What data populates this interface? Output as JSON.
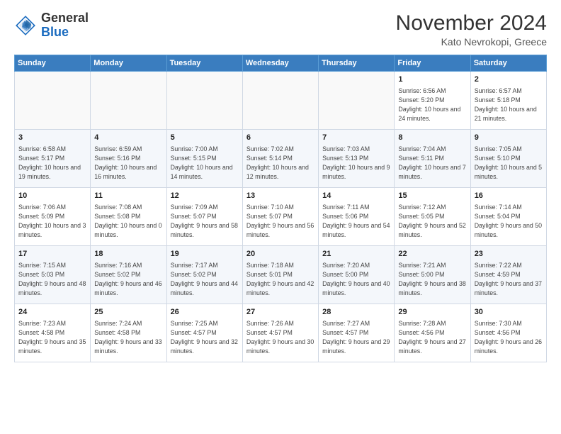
{
  "logo": {
    "line1": "General",
    "line2": "Blue"
  },
  "header": {
    "month": "November 2024",
    "location": "Kato Nevrokopi, Greece"
  },
  "days_of_week": [
    "Sunday",
    "Monday",
    "Tuesday",
    "Wednesday",
    "Thursday",
    "Friday",
    "Saturday"
  ],
  "weeks": [
    [
      {
        "day": "",
        "info": ""
      },
      {
        "day": "",
        "info": ""
      },
      {
        "day": "",
        "info": ""
      },
      {
        "day": "",
        "info": ""
      },
      {
        "day": "",
        "info": ""
      },
      {
        "day": "1",
        "info": "Sunrise: 6:56 AM\nSunset: 5:20 PM\nDaylight: 10 hours and 24 minutes."
      },
      {
        "day": "2",
        "info": "Sunrise: 6:57 AM\nSunset: 5:18 PM\nDaylight: 10 hours and 21 minutes."
      }
    ],
    [
      {
        "day": "3",
        "info": "Sunrise: 6:58 AM\nSunset: 5:17 PM\nDaylight: 10 hours and 19 minutes."
      },
      {
        "day": "4",
        "info": "Sunrise: 6:59 AM\nSunset: 5:16 PM\nDaylight: 10 hours and 16 minutes."
      },
      {
        "day": "5",
        "info": "Sunrise: 7:00 AM\nSunset: 5:15 PM\nDaylight: 10 hours and 14 minutes."
      },
      {
        "day": "6",
        "info": "Sunrise: 7:02 AM\nSunset: 5:14 PM\nDaylight: 10 hours and 12 minutes."
      },
      {
        "day": "7",
        "info": "Sunrise: 7:03 AM\nSunset: 5:13 PM\nDaylight: 10 hours and 9 minutes."
      },
      {
        "day": "8",
        "info": "Sunrise: 7:04 AM\nSunset: 5:11 PM\nDaylight: 10 hours and 7 minutes."
      },
      {
        "day": "9",
        "info": "Sunrise: 7:05 AM\nSunset: 5:10 PM\nDaylight: 10 hours and 5 minutes."
      }
    ],
    [
      {
        "day": "10",
        "info": "Sunrise: 7:06 AM\nSunset: 5:09 PM\nDaylight: 10 hours and 3 minutes."
      },
      {
        "day": "11",
        "info": "Sunrise: 7:08 AM\nSunset: 5:08 PM\nDaylight: 10 hours and 0 minutes."
      },
      {
        "day": "12",
        "info": "Sunrise: 7:09 AM\nSunset: 5:07 PM\nDaylight: 9 hours and 58 minutes."
      },
      {
        "day": "13",
        "info": "Sunrise: 7:10 AM\nSunset: 5:07 PM\nDaylight: 9 hours and 56 minutes."
      },
      {
        "day": "14",
        "info": "Sunrise: 7:11 AM\nSunset: 5:06 PM\nDaylight: 9 hours and 54 minutes."
      },
      {
        "day": "15",
        "info": "Sunrise: 7:12 AM\nSunset: 5:05 PM\nDaylight: 9 hours and 52 minutes."
      },
      {
        "day": "16",
        "info": "Sunrise: 7:14 AM\nSunset: 5:04 PM\nDaylight: 9 hours and 50 minutes."
      }
    ],
    [
      {
        "day": "17",
        "info": "Sunrise: 7:15 AM\nSunset: 5:03 PM\nDaylight: 9 hours and 48 minutes."
      },
      {
        "day": "18",
        "info": "Sunrise: 7:16 AM\nSunset: 5:02 PM\nDaylight: 9 hours and 46 minutes."
      },
      {
        "day": "19",
        "info": "Sunrise: 7:17 AM\nSunset: 5:02 PM\nDaylight: 9 hours and 44 minutes."
      },
      {
        "day": "20",
        "info": "Sunrise: 7:18 AM\nSunset: 5:01 PM\nDaylight: 9 hours and 42 minutes."
      },
      {
        "day": "21",
        "info": "Sunrise: 7:20 AM\nSunset: 5:00 PM\nDaylight: 9 hours and 40 minutes."
      },
      {
        "day": "22",
        "info": "Sunrise: 7:21 AM\nSunset: 5:00 PM\nDaylight: 9 hours and 38 minutes."
      },
      {
        "day": "23",
        "info": "Sunrise: 7:22 AM\nSunset: 4:59 PM\nDaylight: 9 hours and 37 minutes."
      }
    ],
    [
      {
        "day": "24",
        "info": "Sunrise: 7:23 AM\nSunset: 4:58 PM\nDaylight: 9 hours and 35 minutes."
      },
      {
        "day": "25",
        "info": "Sunrise: 7:24 AM\nSunset: 4:58 PM\nDaylight: 9 hours and 33 minutes."
      },
      {
        "day": "26",
        "info": "Sunrise: 7:25 AM\nSunset: 4:57 PM\nDaylight: 9 hours and 32 minutes."
      },
      {
        "day": "27",
        "info": "Sunrise: 7:26 AM\nSunset: 4:57 PM\nDaylight: 9 hours and 30 minutes."
      },
      {
        "day": "28",
        "info": "Sunrise: 7:27 AM\nSunset: 4:57 PM\nDaylight: 9 hours and 29 minutes."
      },
      {
        "day": "29",
        "info": "Sunrise: 7:28 AM\nSunset: 4:56 PM\nDaylight: 9 hours and 27 minutes."
      },
      {
        "day": "30",
        "info": "Sunrise: 7:30 AM\nSunset: 4:56 PM\nDaylight: 9 hours and 26 minutes."
      }
    ]
  ]
}
